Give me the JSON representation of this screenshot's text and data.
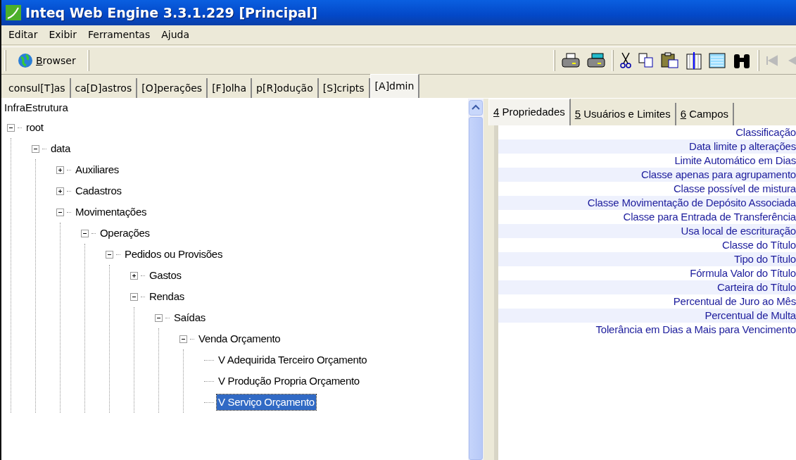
{
  "window": {
    "title": "Inteq Web Engine 3.3.1.229 [Principal]"
  },
  "menu": [
    "Editar",
    "Exibir",
    "Ferramentas",
    "Ajuda"
  ],
  "toolbar": {
    "browser_button": {
      "label": "Browser",
      "underline_first": true
    }
  },
  "tabs": [
    {
      "label": "consul[T]as",
      "selected": false
    },
    {
      "label": "ca[D]astros",
      "selected": false
    },
    {
      "label": "[O]perações",
      "selected": false
    },
    {
      "label": "[F]olha",
      "selected": false
    },
    {
      "label": "p[R]odução",
      "selected": false
    },
    {
      "label": "[S]cripts",
      "selected": false
    },
    {
      "label": "[A]dmin",
      "selected": true
    }
  ],
  "tree": {
    "title": "InfraEstrutura",
    "items": [
      {
        "label": "root",
        "kind": "branch",
        "expanded": true,
        "selected": false,
        "children": [
          {
            "label": "data",
            "kind": "branch",
            "expanded": true,
            "selected": false,
            "children": [
              {
                "label": "Auxiliares",
                "kind": "branch",
                "expanded": false,
                "selected": false
              },
              {
                "label": "Cadastros",
                "kind": "branch",
                "expanded": false,
                "selected": false
              },
              {
                "label": "Movimentações",
                "kind": "branch",
                "expanded": true,
                "selected": false,
                "children": [
                  {
                    "label": "Operações",
                    "kind": "branch",
                    "expanded": true,
                    "selected": false,
                    "children": [
                      {
                        "label": "Pedidos ou Provisões",
                        "kind": "branch",
                        "expanded": true,
                        "selected": false,
                        "children": [
                          {
                            "label": "Gastos",
                            "kind": "branch",
                            "expanded": false,
                            "selected": false
                          },
                          {
                            "label": "Rendas",
                            "kind": "branch",
                            "expanded": true,
                            "selected": false,
                            "children": [
                              {
                                "label": "Saídas",
                                "kind": "branch",
                                "expanded": true,
                                "selected": false,
                                "children": [
                                  {
                                    "label": "Venda Orçamento",
                                    "kind": "branch",
                                    "expanded": true,
                                    "selected": false,
                                    "children": [
                                      {
                                        "label": "V Adequirida Terceiro Orçamento",
                                        "kind": "leaf",
                                        "selected": false
                                      },
                                      {
                                        "label": "V Produção Propria Orçamento",
                                        "kind": "leaf",
                                        "selected": false
                                      },
                                      {
                                        "label": "V Serviço Orçamento",
                                        "kind": "leaf",
                                        "selected": true
                                      }
                                    ]
                                  }
                                ]
                              }
                            ]
                          }
                        ]
                      }
                    ]
                  }
                ]
              }
            ]
          }
        ]
      }
    ]
  },
  "detail_tabs": [
    {
      "label": "4 Propriedades",
      "underline_first": true,
      "selected": true
    },
    {
      "label": "5 Usuários e Limites",
      "underline_first": true,
      "selected": false
    },
    {
      "label": "6 Campos",
      "underline_first": true,
      "selected": false
    }
  ],
  "properties": [
    "Classificação",
    "Data limite p alterações",
    "Limite Automático em Dias",
    "Classe apenas para agrupamento",
    "Classe possível de mistura",
    "Classe Movimentação de Depósito Associada",
    "Classe para Entrada de Transferência",
    "Usa local de escrituração",
    "Classe do Título",
    "Tipo do Título",
    "Fórmula Valor do Título",
    "Carteira do Título",
    "Percentual de Juro ao Mês",
    "Percentual de Multa",
    "Tolerância em Dias a Mais para Vencimento"
  ]
}
